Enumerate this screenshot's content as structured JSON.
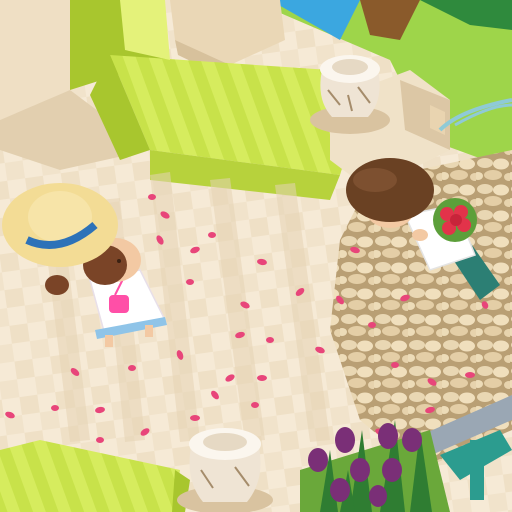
{
  "scene": {
    "palette": {
      "path_light": "#f6ead6",
      "path_mid": "#ecdcc0",
      "path_shade": "#dccaa9",
      "lime": "#c8e24a",
      "lime_dark": "#a8c62e",
      "lime_light": "#e4f27a",
      "cobble": "#e6d3ad",
      "cobble_line": "#b99f74",
      "petal": "#e8457a",
      "girl_hat": "#f3dc95",
      "hat_band": "#2d72b8",
      "girl_dress": "#ffffff",
      "girl_bag": "#ff4fa7",
      "boy_hair": "#6a4123",
      "boy_shirt": "#ffffff",
      "boy_pants": "#2c7f74",
      "rose": "#e2334a",
      "tulip": "#7a2f77",
      "water": "#3ba7e0",
      "grass": "#9ed54a"
    },
    "characters": [
      {
        "id": "girl",
        "description_icon": "girl-character-icon"
      },
      {
        "id": "boy",
        "description_icon": "boy-character-icon"
      }
    ],
    "props": [
      "stone-urn-icon",
      "rose-bouquet-icon",
      "tulip-bed-icon",
      "flower-petals-icon",
      "park-bench-icon"
    ]
  }
}
